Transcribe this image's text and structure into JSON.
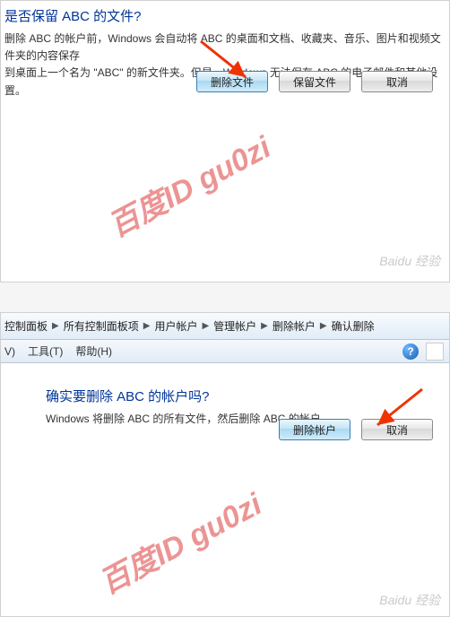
{
  "top": {
    "title": "是否保留 ABC 的文件?",
    "body_line1": "删除 ABC 的帐户前，Windows 会自动将 ABC 的桌面和文档、收藏夹、音乐、图片和视频文件夹的内容保存",
    "body_line2": "到桌面上一个名为 \"ABC\" 的新文件夹。但是，Windows 无法保存 ABC 的电子邮件和其他设置。",
    "buttons": {
      "delete_files": "删除文件",
      "keep_files": "保留文件",
      "cancel": "取消"
    }
  },
  "bottom": {
    "breadcrumbs": [
      "控制面板",
      "所有控制面板项",
      "用户帐户",
      "管理帐户",
      "删除帐户",
      "确认删除"
    ],
    "menu": {
      "view": "V)",
      "tools": "工具(T)",
      "help": "帮助(H)"
    },
    "title": "确实要删除 ABC 的帐户吗?",
    "body": "Windows 将删除 ABC 的所有文件，然后删除 ABC 的帐户。",
    "buttons": {
      "delete_account": "删除帐户",
      "cancel": "取消"
    }
  },
  "watermark": "百度ID gu0zi",
  "baidu": "Baidu 经验"
}
